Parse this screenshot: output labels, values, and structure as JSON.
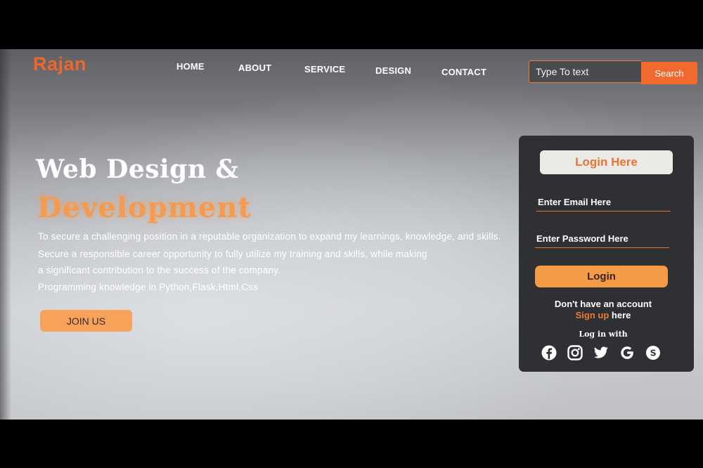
{
  "brand": {
    "name": "Rajan",
    "accent_color": "#f0662a"
  },
  "nav": {
    "items": [
      {
        "label": "HOME"
      },
      {
        "label": "ABOUT"
      },
      {
        "label": "SERVICE"
      },
      {
        "label": "DESIGN"
      },
      {
        "label": "CONTACT"
      }
    ]
  },
  "search": {
    "placeholder": "Type To text",
    "button_label": "Search"
  },
  "hero": {
    "title_line1": "Web Design &",
    "title_line2": "Development",
    "lines": [
      "To secure a challenging position in a reputable organization to expand my learnings, knowledge, and skills.",
      "Secure a responsible career opportunity to fully utilize my training and skills, while making",
      "a significant contribution to the success of the company.",
      "Programming knowledge in Python,Flask,Html,Css"
    ],
    "join_button": "JOIN US"
  },
  "login": {
    "heading": "Login Here",
    "email_placeholder": "Enter Email Here",
    "password_placeholder": "Enter Password Here",
    "button_label": "Login",
    "no_account_text": "Don't have an account",
    "signup_link": "Sign up",
    "signup_suffix": " here",
    "login_with_text": "Log in with",
    "socials": [
      {
        "icon": "facebook-icon"
      },
      {
        "icon": "instagram-icon"
      },
      {
        "icon": "twitter-icon"
      },
      {
        "icon": "google-icon"
      },
      {
        "icon": "skype-icon"
      }
    ]
  }
}
